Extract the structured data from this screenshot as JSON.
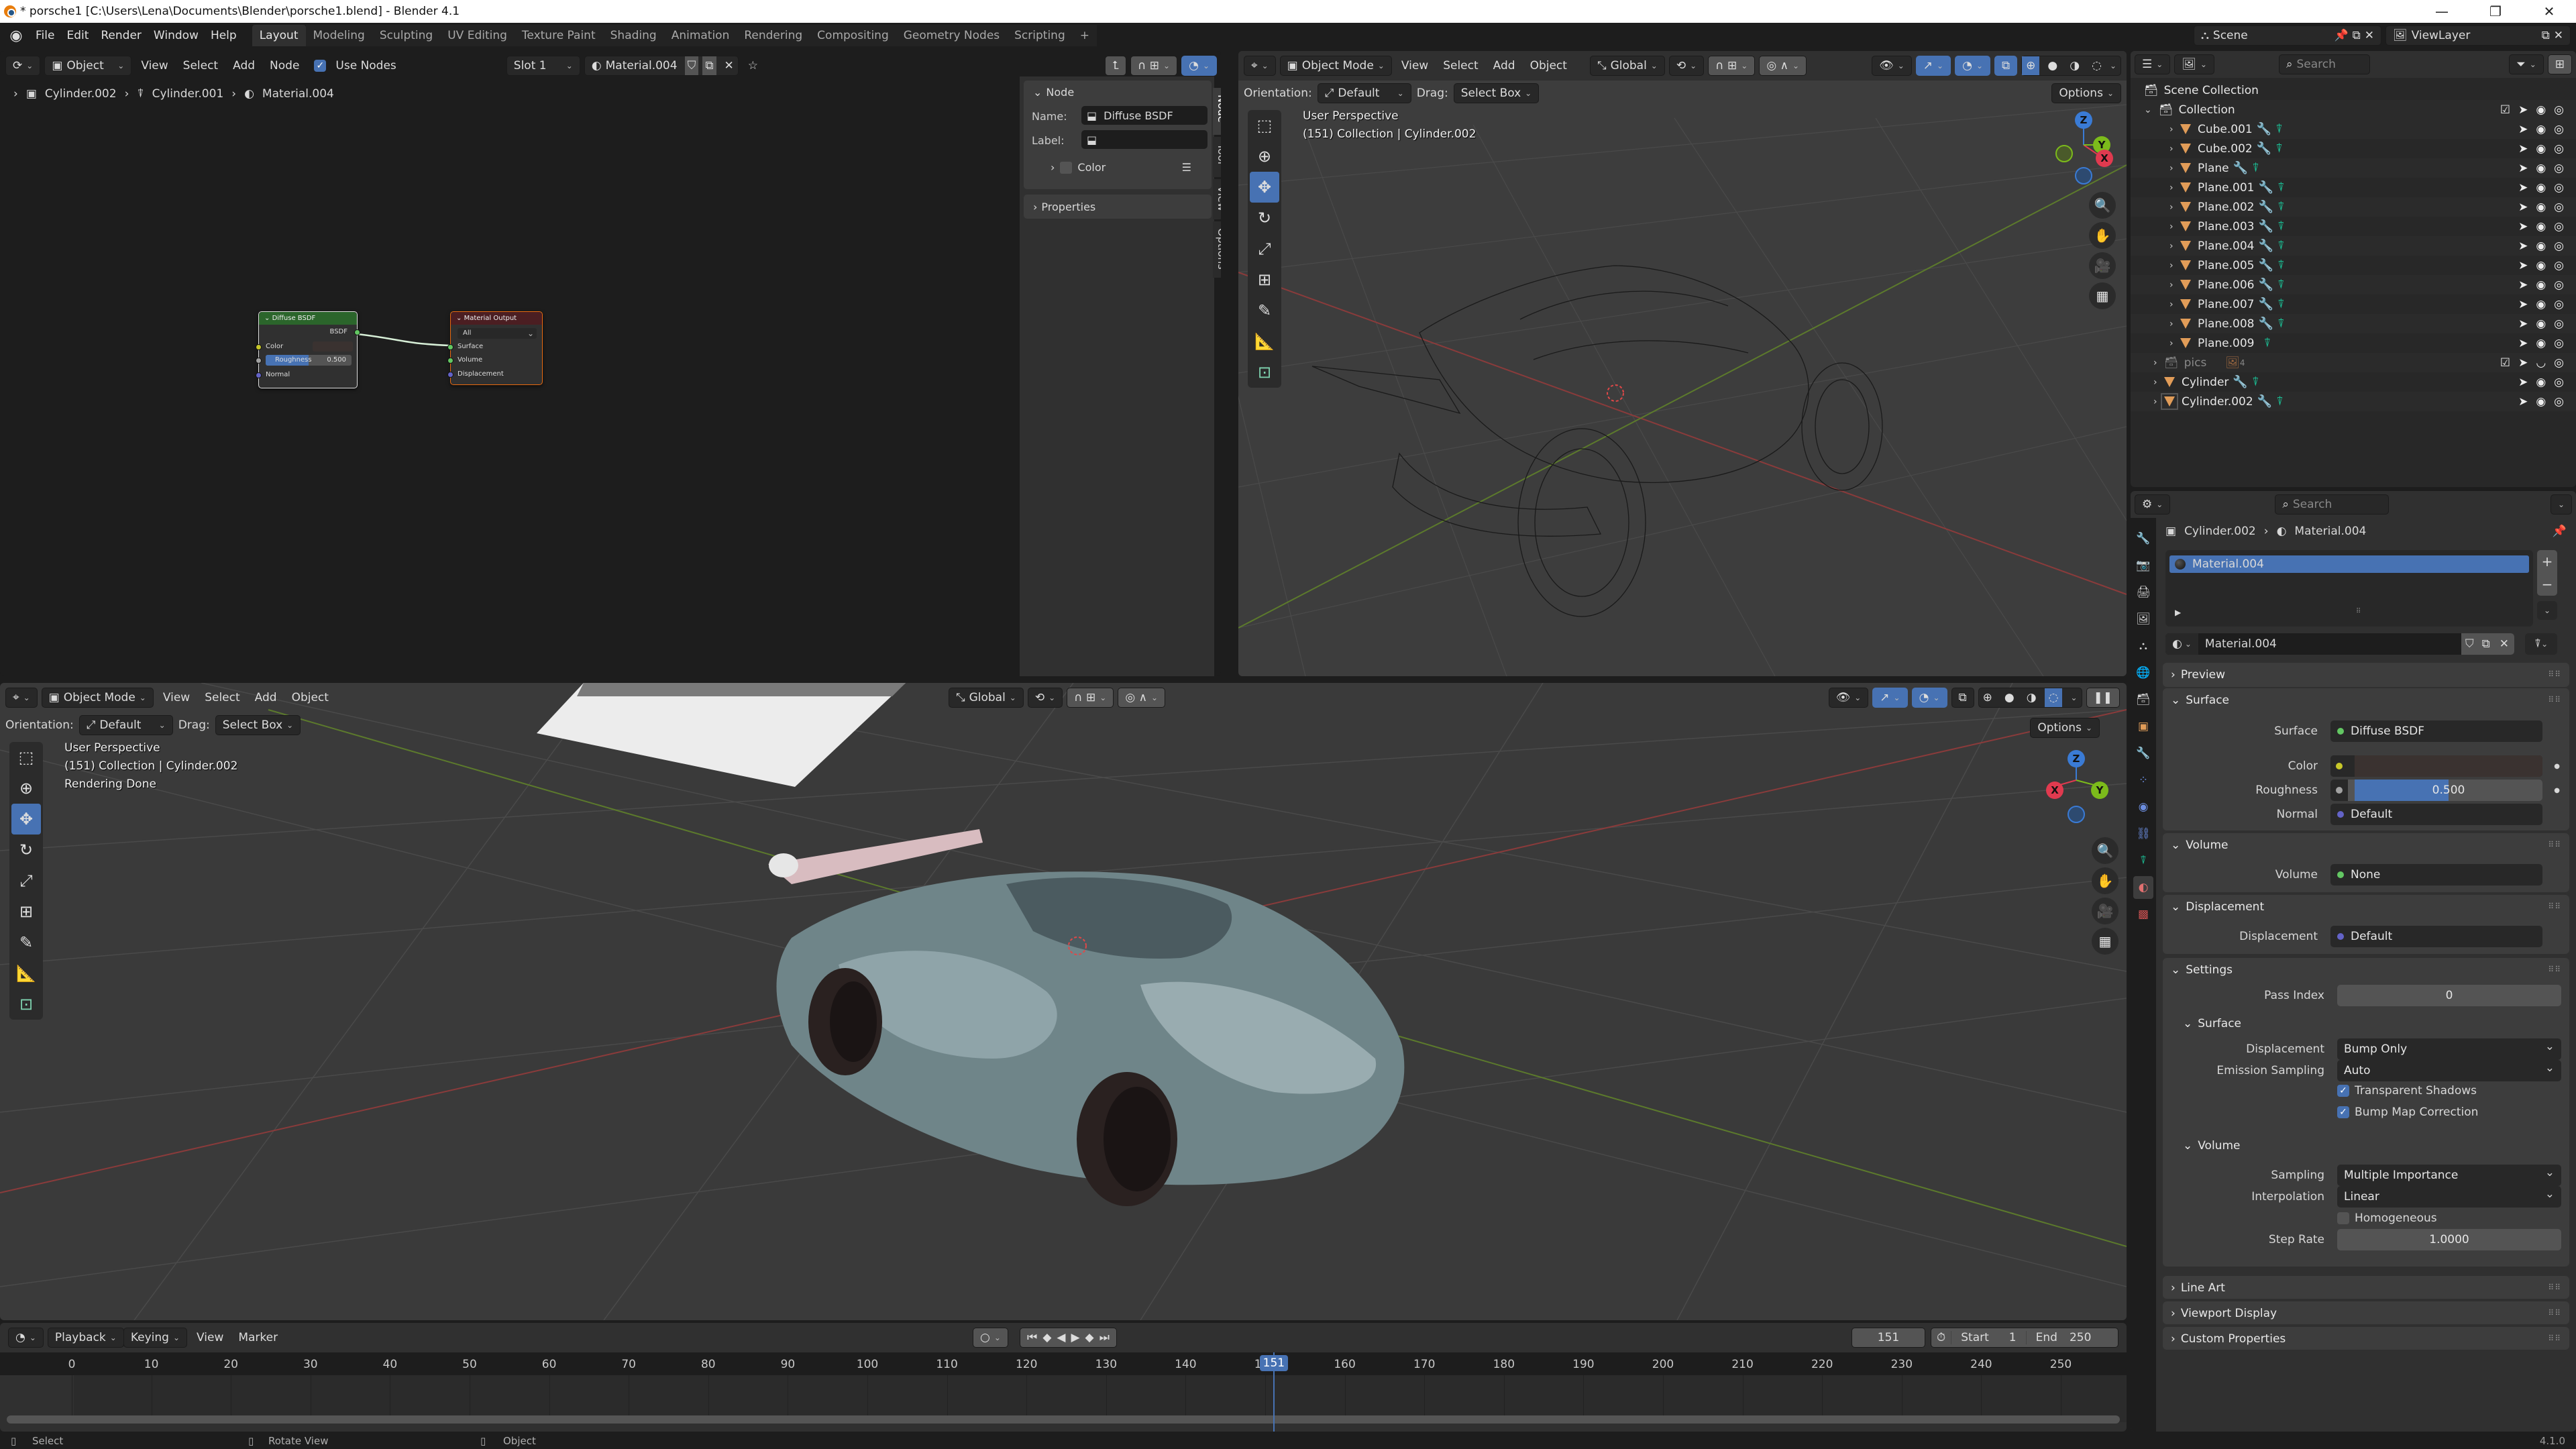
{
  "window": {
    "title": "* porsche1 [C:\\Users\\Lena\\Documents\\Blender\\porsche1.blend] - Blender 4.1",
    "controls": [
      "minimize",
      "maximize",
      "close"
    ]
  },
  "menubar": {
    "items": [
      "File",
      "Edit",
      "Render",
      "Window",
      "Help"
    ],
    "workspaces": [
      "Layout",
      "Modeling",
      "Sculpting",
      "UV Editing",
      "Texture Paint",
      "Shading",
      "Animation",
      "Rendering",
      "Compositing",
      "Geometry Nodes",
      "Scripting"
    ],
    "active_workspace": "Layout",
    "add_workspace": "+"
  },
  "node_editor": {
    "header": {
      "mode": "Object",
      "menus": [
        "View",
        "Select",
        "Add",
        "Node"
      ],
      "use_nodes_label": "Use Nodes",
      "use_nodes_checked": true,
      "slot": "Slot 1",
      "material": "Material.004"
    },
    "breadcrumb": [
      "Cylinder.002",
      "Cylinder.001",
      "Material.004"
    ],
    "nodes": {
      "diffuse": {
        "title": "Diffuse BSDF",
        "output": "BSDF",
        "inputs": [
          "Color",
          "Roughness",
          "Normal"
        ],
        "roughness_value": "0.500",
        "roughness_fraction": 0.5,
        "header_color": "#2b652b"
      },
      "output": {
        "title": "Material Output",
        "target": "All",
        "inputs": [
          "Surface",
          "Volume",
          "Displacement"
        ],
        "header_color": "#4b1e22"
      }
    },
    "sidebar": {
      "panel_title": "Node",
      "name_label": "Name:",
      "name_value": "Diffuse BSDF",
      "label_label": "Label:",
      "label_value": "",
      "color_label": "Color",
      "properties_label": "Properties",
      "tabs": [
        "Node",
        "Tool",
        "View",
        "Options"
      ],
      "active_tab": "Node"
    }
  },
  "viewport_top": {
    "mode": "Object Mode",
    "menus": [
      "View",
      "Select",
      "Add",
      "Object"
    ],
    "transform_orientation": "Global",
    "orientation_label": "Orientation:",
    "orientation_value": "Default",
    "drag_label": "Drag:",
    "drag_value": "Select Box",
    "options_label": "Options",
    "info_line1": "User Perspective",
    "info_line2": "(151) Collection | Cylinder.002",
    "shading": "wireframe"
  },
  "viewport_bottom": {
    "mode": "Object Mode",
    "menus": [
      "View",
      "Select",
      "Add",
      "Object"
    ],
    "transform_orientation": "Global",
    "orientation_label": "Orientation:",
    "orientation_value": "Default",
    "drag_label": "Drag:",
    "drag_value": "Select Box",
    "options_label": "Options",
    "info_line1": "User Perspective",
    "info_line2": "(151) Collection | Cylinder.002",
    "info_line3": "Rendering Done",
    "shading": "rendered"
  },
  "gizmo": {
    "x": "X",
    "y": "Y",
    "z": "Z"
  },
  "outliner": {
    "scene": "Scene",
    "view_layer": "ViewLayer",
    "search_placeholder": "Search",
    "scene_collection": "Scene Collection",
    "collection": "Collection",
    "objects": [
      {
        "name": "Cube.001",
        "modifier": true
      },
      {
        "name": "Cube.002",
        "modifier": true
      },
      {
        "name": "Plane",
        "modifier": true
      },
      {
        "name": "Plane.001",
        "modifier": true
      },
      {
        "name": "Plane.002",
        "modifier": true
      },
      {
        "name": "Plane.003",
        "modifier": true
      },
      {
        "name": "Plane.004",
        "modifier": true
      },
      {
        "name": "Plane.005",
        "modifier": true
      },
      {
        "name": "Plane.006",
        "modifier": true
      },
      {
        "name": "Plane.007",
        "modifier": true
      },
      {
        "name": "Plane.008",
        "modifier": true
      },
      {
        "name": "Plane.009",
        "modifier": false
      }
    ],
    "pics_collection": "pics",
    "pics_count": "4",
    "root_objects": [
      {
        "name": "Cylinder",
        "modifier": true
      },
      {
        "name": "Cylinder.002",
        "modifier": true,
        "active": true
      }
    ]
  },
  "properties": {
    "search_placeholder": "Search",
    "breadcrumb": [
      "Cylinder.002",
      "Material.004"
    ],
    "slot_list": [
      "Material.004"
    ],
    "material_name": "Material.004",
    "sections": {
      "preview": "Preview",
      "surface": "Surface",
      "volume": "Volume",
      "displacement": "Displacement",
      "settings": "Settings",
      "line_art": "Line Art",
      "viewport_display": "Viewport Display",
      "custom_properties": "Custom Properties"
    },
    "surface": {
      "surface_label": "Surface",
      "surface_value": "Diffuse BSDF",
      "color_label": "Color",
      "color_value": "#3a3230",
      "roughness_label": "Roughness",
      "roughness_value": "0.500",
      "roughness_fraction": 0.5,
      "normal_label": "Normal",
      "normal_value": "Default"
    },
    "volume": {
      "volume_label": "Volume",
      "volume_value": "None"
    },
    "displacement": {
      "displacement_label": "Displacement",
      "displacement_value": "Default"
    },
    "settings": {
      "pass_index_label": "Pass Index",
      "pass_index_value": "0",
      "surface_sub": "Surface",
      "displacement_label": "Displacement",
      "displacement_value": "Bump Only",
      "emission_sampling_label": "Emission Sampling",
      "emission_sampling_value": "Auto",
      "transparent_shadows_label": "Transparent Shadows",
      "transparent_shadows": true,
      "bump_map_correction_label": "Bump Map Correction",
      "bump_map_correction": true,
      "volume_sub": "Volume",
      "sampling_label": "Sampling",
      "sampling_value": "Multiple Importance",
      "interpolation_label": "Interpolation",
      "interpolation_value": "Linear",
      "homogeneous_label": "Homogeneous",
      "homogeneous": false,
      "step_rate_label": "Step Rate",
      "step_rate_value": "1.0000"
    }
  },
  "timeline": {
    "menus": [
      "Playback",
      "Keying",
      "View",
      "Marker"
    ],
    "current_frame": "151",
    "start_label": "Start",
    "start_value": "1",
    "end_label": "End",
    "end_value": "250",
    "ticks": [
      "0",
      "10",
      "20",
      "30",
      "40",
      "50",
      "60",
      "70",
      "80",
      "90",
      "100",
      "110",
      "120",
      "130",
      "140",
      "150",
      "160",
      "170",
      "180",
      "190",
      "200",
      "210",
      "220",
      "230",
      "240",
      "250"
    ]
  },
  "statusbar": {
    "select": "Select",
    "rotate_view": "Rotate View",
    "object": "Object",
    "version": "4.1.0"
  },
  "colors": {
    "accent": "#4772b3",
    "object_icon": "#e19c58",
    "modifier_icon": "#6c8ee0",
    "mesh_icon": "#1bbf95",
    "socket_shader": "#63c763",
    "socket_color": "#c7c729",
    "socket_float": "#a1a1a1",
    "socket_vector": "#6363c7"
  }
}
